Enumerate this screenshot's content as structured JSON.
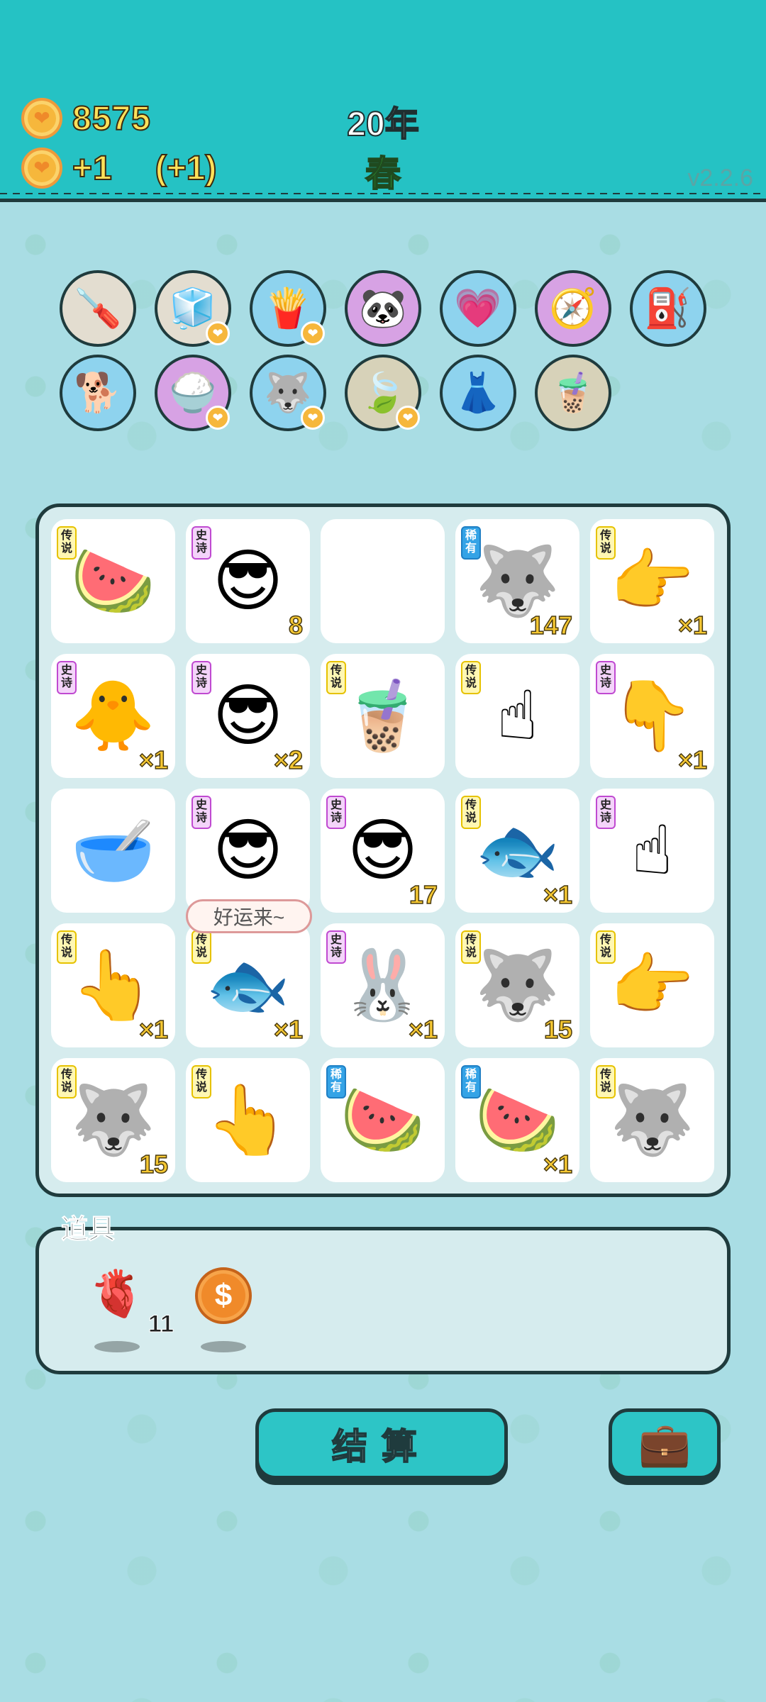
{
  "header": {
    "coins": "8575",
    "income": "+1",
    "income_extra": "(+1)",
    "year": "20年",
    "season": "春",
    "version": "v2.2.6"
  },
  "relics": [
    {
      "icon": "screwdriver-icon",
      "glyph": "🪛",
      "color": "beige",
      "badge": false
    },
    {
      "icon": "sugar-cubes-icon",
      "glyph": "🧊",
      "color": "beige",
      "badge": true
    },
    {
      "icon": "french-fries-icon",
      "glyph": "🍟",
      "color": "blue",
      "badge": true
    },
    {
      "icon": "panda-icon",
      "glyph": "🐼",
      "color": "purple",
      "badge": false
    },
    {
      "icon": "heart-potion-icon",
      "glyph": "💗",
      "color": "blue",
      "badge": false
    },
    {
      "icon": "compass-icon",
      "glyph": "🧭",
      "color": "purple",
      "badge": false
    },
    {
      "icon": "pump-icon",
      "glyph": "⛽",
      "color": "blue",
      "badge": false
    },
    {
      "icon": "dog-with-chain-icon",
      "glyph": "🐕",
      "color": "blue",
      "badge": false
    },
    {
      "icon": "rice-bowl-icon",
      "glyph": "🍚",
      "color": "purple",
      "badge": true
    },
    {
      "icon": "husky-icon",
      "glyph": "🐺",
      "color": "blue",
      "badge": true
    },
    {
      "icon": "leaf-icon",
      "glyph": "🍃",
      "color": "olive",
      "badge": true
    },
    {
      "icon": "skirt-icon",
      "glyph": "👗",
      "color": "blue",
      "badge": false
    },
    {
      "icon": "bubble-tea-icon",
      "glyph": "🧋",
      "color": "olive",
      "badge": false
    }
  ],
  "board": [
    {
      "tag": "传说",
      "rarity": "legend",
      "icon": "watermelon-icon",
      "glyph": "🍉",
      "count": ""
    },
    {
      "tag": "史诗",
      "rarity": "epic",
      "icon": "sunglasses-man-icon",
      "glyph": "😎",
      "count": "8"
    },
    {
      "tag": "",
      "rarity": "",
      "icon": "",
      "glyph": "",
      "count": ""
    },
    {
      "tag": "稀有",
      "rarity": "rare",
      "icon": "husky-with-coin-icon",
      "glyph": "🐺",
      "count": "147"
    },
    {
      "tag": "传说",
      "rarity": "legend",
      "icon": "pointing-hand-right-icon",
      "glyph": "👉",
      "count": "×1"
    },
    {
      "tag": "史诗",
      "rarity": "epic",
      "icon": "yellow-chick-icon",
      "glyph": "🐥",
      "count": "×1"
    },
    {
      "tag": "史诗",
      "rarity": "epic",
      "icon": "sunglasses-man-icon",
      "glyph": "😎",
      "count": "×2"
    },
    {
      "tag": "传说",
      "rarity": "legend",
      "icon": "bubble-tea-icon",
      "glyph": "🧋",
      "count": ""
    },
    {
      "tag": "传说",
      "rarity": "legend",
      "icon": "pointing-hand-up-icon",
      "glyph": "☝",
      "count": ""
    },
    {
      "tag": "史诗",
      "rarity": "epic",
      "icon": "gray-hand-icon",
      "glyph": "👇",
      "count": "×1"
    },
    {
      "tag": "",
      "rarity": "",
      "icon": "lucky-bowl-icon",
      "glyph": "🥣",
      "count": ""
    },
    {
      "tag": "史诗",
      "rarity": "epic",
      "icon": "sunglasses-man-icon",
      "glyph": "😎",
      "count": ""
    },
    {
      "tag": "史诗",
      "rarity": "epic",
      "icon": "sunglasses-man-icon",
      "glyph": "😎",
      "count": "17"
    },
    {
      "tag": "传说",
      "rarity": "legend",
      "icon": "koi-fish-icon",
      "glyph": "🐟",
      "count": "×1"
    },
    {
      "tag": "史诗",
      "rarity": "epic",
      "icon": "gray-pointing-hand-icon",
      "glyph": "☝",
      "count": ""
    },
    {
      "tag": "传说",
      "rarity": "legend",
      "icon": "pointing-hand-up-icon",
      "glyph": "👆",
      "count": "×1"
    },
    {
      "tag": "传说",
      "rarity": "legend",
      "icon": "koi-fish-icon",
      "glyph": "🐟",
      "count": "×1"
    },
    {
      "tag": "史诗",
      "rarity": "epic",
      "icon": "rabbit-house-icon",
      "glyph": "🐰",
      "count": "×1"
    },
    {
      "tag": "传说",
      "rarity": "legend",
      "icon": "crowned-husky-icon",
      "glyph": "🐺",
      "count": "15"
    },
    {
      "tag": "传说",
      "rarity": "legend",
      "icon": "pointing-hand-diagonal-icon",
      "glyph": "👉",
      "count": ""
    },
    {
      "tag": "传说",
      "rarity": "legend",
      "icon": "crowned-husky-icon",
      "glyph": "🐺",
      "count": "15"
    },
    {
      "tag": "传说",
      "rarity": "legend",
      "icon": "pointing-hand-up-icon",
      "glyph": "👆",
      "count": ""
    },
    {
      "tag": "稀有",
      "rarity": "rare",
      "icon": "watermelon-slice-icon",
      "glyph": "🍉",
      "count": ""
    },
    {
      "tag": "稀有",
      "rarity": "rare",
      "icon": "watermelon-slice-icon",
      "glyph": "🍉",
      "count": "×1"
    },
    {
      "tag": "传说",
      "rarity": "legend",
      "icon": "crowned-husky-icon",
      "glyph": "🐺",
      "count": ""
    }
  ],
  "bubble_text": "好运来~",
  "items": {
    "title": "道具",
    "list": [
      {
        "icon": "liver-icon",
        "glyph": "🫀",
        "qty": "11"
      },
      {
        "icon": "dollar-coin-icon",
        "glyph": "$",
        "qty": ""
      }
    ]
  },
  "buttons": {
    "settle": "结算",
    "bag": "briefcase-icon"
  },
  "colors": {
    "header_bg": "#25c2c4",
    "page_bg": "#a9dde4",
    "coin_text": "#ffe15a",
    "season_text": "#3fd23f"
  }
}
